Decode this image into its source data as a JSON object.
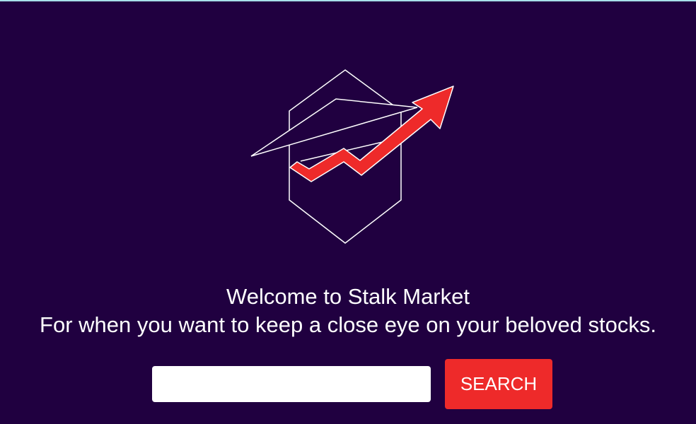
{
  "header": {
    "welcome": "Welcome to Stalk Market",
    "tagline": "For when you want to keep a close eye on your beloved stocks."
  },
  "search": {
    "placeholder": "",
    "value": "",
    "button_label": "SEARCH"
  },
  "logo": {
    "icon": "paper-plane-stock-arrow-icon"
  },
  "colors": {
    "background": "#200040",
    "accent": "#ee2a2a",
    "outline": "#ffffff",
    "top_border": "#a8e0ea"
  }
}
